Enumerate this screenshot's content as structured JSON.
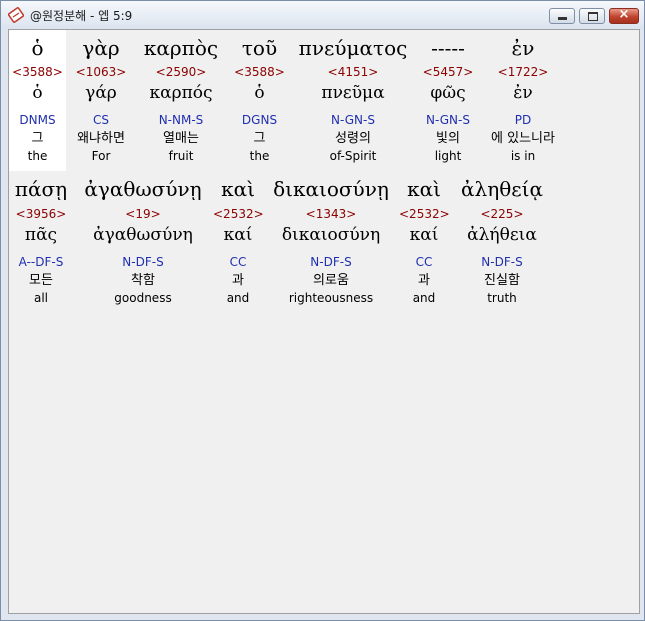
{
  "window": {
    "title": "@원정분해 - 엡 5:9",
    "controls": {
      "close": "×"
    }
  },
  "rows": [
    {
      "words": [
        {
          "greek": "ὁ",
          "strong": "<3588>",
          "lemma": "ὁ",
          "morph": "DNMS",
          "korean": "그",
          "english": "the"
        },
        {
          "greek": "γὰρ",
          "strong": "<1063>",
          "lemma": "γάρ",
          "morph": "CS",
          "korean": "왜냐하면",
          "english": "For"
        },
        {
          "greek": "καρπὸς",
          "strong": "<2590>",
          "lemma": "καρπός",
          "morph": "N-NM-S",
          "korean": "열매는",
          "english": "fruit"
        },
        {
          "greek": "τοῦ",
          "strong": "<3588>",
          "lemma": "ὁ",
          "morph": "DGNS",
          "korean": "그",
          "english": "the"
        },
        {
          "greek": "πνεύματος",
          "strong": "<4151>",
          "lemma": "πνεῦμα",
          "morph": "N-GN-S",
          "korean": "성령의",
          "english": "of-Spirit"
        },
        {
          "greek": "-----",
          "strong": "<5457>",
          "lemma": "φῶς",
          "morph": "N-GN-S",
          "korean": "빛의",
          "english": "light"
        },
        {
          "greek": "ἐν",
          "strong": "<1722>",
          "lemma": "ἐν",
          "morph": "PD",
          "korean": "에 있느니라",
          "english": "is in"
        }
      ]
    },
    {
      "words": [
        {
          "greek": "πάσῃ",
          "strong": "<3956>",
          "lemma": "πᾶς",
          "morph": "A--DF-S",
          "korean": "모든",
          "english": "all"
        },
        {
          "greek": "ἀγαθωσύνῃ",
          "strong": "<19>",
          "lemma": "ἀγαθωσύνη",
          "morph": "N-DF-S",
          "korean": "착함",
          "english": "goodness"
        },
        {
          "greek": "καὶ",
          "strong": "<2532>",
          "lemma": "καί",
          "morph": "CC",
          "korean": "과",
          "english": "and"
        },
        {
          "greek": "δικαιοσύνῃ",
          "strong": "<1343>",
          "lemma": "δικαιοσύνη",
          "morph": "N-DF-S",
          "korean": "의로움",
          "english": "righteousness"
        },
        {
          "greek": "καὶ",
          "strong": "<2532>",
          "lemma": "καί",
          "morph": "CC",
          "korean": "과",
          "english": "and"
        },
        {
          "greek": "ἀληθείᾳ",
          "strong": "<225>",
          "lemma": "ἀλήθεια",
          "morph": "N-DF-S",
          "korean": "진실함",
          "english": "truth"
        }
      ]
    }
  ]
}
